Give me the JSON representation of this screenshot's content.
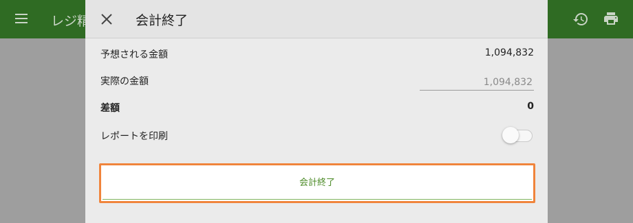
{
  "app_bar": {
    "title": "レジ精算",
    "icons": [
      "menu-icon",
      "history-icon",
      "print-icon"
    ],
    "color": "#2f6b23"
  },
  "dialog": {
    "close_icon": "close-icon",
    "title": "会計終了",
    "expected_label": "予想される金額",
    "expected_value": "1,094,832",
    "actual_label": "実際の金額",
    "actual_value": "1,094,832",
    "difference_label": "差額",
    "difference_value": "0",
    "print_report_label": "レポートを印刷",
    "print_report_enabled": false,
    "finish_button_label": "会計終了",
    "accent_color": "#f0843b",
    "button_text_color": "#4b8a26"
  }
}
